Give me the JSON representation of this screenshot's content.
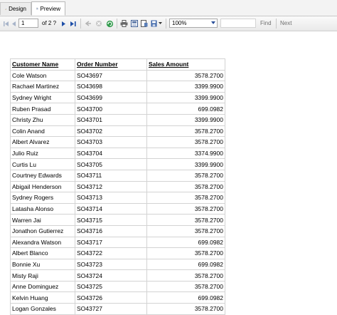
{
  "tabs": {
    "design_label": "Design",
    "preview_label": "Preview"
  },
  "toolbar": {
    "page_value": "1",
    "of_label": "of 2 ?",
    "zoom_value": "100%",
    "find_label": "Find",
    "next_label": "Next",
    "icons": [
      "first-page-icon",
      "previous-page-icon",
      "next-page-icon",
      "last-page-icon",
      "back-icon",
      "stop-icon",
      "refresh-icon",
      "print-icon",
      "print-layout-icon",
      "page-setup-icon",
      "export-icon"
    ]
  },
  "report": {
    "headers": [
      "Customer Name",
      "Order Number",
      "Sales Amount"
    ],
    "rows": [
      [
        "Cole Watson",
        "SO43697",
        "3578.2700"
      ],
      [
        "Rachael Martinez",
        "SO43698",
        "3399.9900"
      ],
      [
        "Sydney Wright",
        "SO43699",
        "3399.9900"
      ],
      [
        "Ruben Prasad",
        "SO43700",
        "699.0982"
      ],
      [
        "Christy Zhu",
        "SO43701",
        "3399.9900"
      ],
      [
        "Colin Anand",
        "SO43702",
        "3578.2700"
      ],
      [
        "Albert Alvarez",
        "SO43703",
        "3578.2700"
      ],
      [
        "Julio Ruiz",
        "SO43704",
        "3374.9900"
      ],
      [
        "Curtis Lu",
        "SO43705",
        "3399.9900"
      ],
      [
        "Courtney Edwards",
        "SO43711",
        "3578.2700"
      ],
      [
        "Abigail Henderson",
        "SO43712",
        "3578.2700"
      ],
      [
        "Sydney Rogers",
        "SO43713",
        "3578.2700"
      ],
      [
        "Latasha Alonso",
        "SO43714",
        "3578.2700"
      ],
      [
        "Warren Jai",
        "SO43715",
        "3578.2700"
      ],
      [
        "Jonathon Gutierrez",
        "SO43716",
        "3578.2700"
      ],
      [
        "Alexandra Watson",
        "SO43717",
        "699.0982"
      ],
      [
        "Albert Blanco",
        "SO43722",
        "3578.2700"
      ],
      [
        "Bonnie Xu",
        "SO43723",
        "699.0982"
      ],
      [
        "Misty Raji",
        "SO43724",
        "3578.2700"
      ],
      [
        "Anne Dominguez",
        "SO43725",
        "3578.2700"
      ],
      [
        "Kelvin Huang",
        "SO43726",
        "699.0982"
      ],
      [
        "Logan Gonzales",
        "SO43727",
        "3578.2700"
      ]
    ]
  },
  "colors": {
    "accent": "#1f4fa8",
    "grid": "#d3d3d3"
  }
}
